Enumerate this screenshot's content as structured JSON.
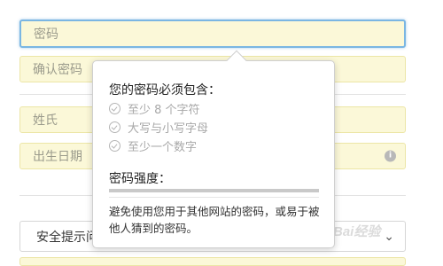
{
  "form": {
    "password_placeholder": "密码",
    "confirm_placeholder": "确认密码",
    "lastname_placeholder": "姓氏",
    "birthdate_placeholder": "出生日期",
    "security_question_label": "安全提示问题"
  },
  "popover": {
    "title": "您的密码必须包含：",
    "requirements": [
      {
        "text": "至少 8 个字符",
        "met": false
      },
      {
        "text": "大写与小写字母",
        "met": false
      },
      {
        "text": "至少一个数字",
        "met": false
      }
    ],
    "strength_label": "密码强度：",
    "strength_level": 0,
    "hint": "避免使用您用于其他网站的密码，或易于被他人猜到的密码。"
  },
  "watermark": {
    "text": "Bai经验"
  },
  "colors": {
    "field_bg": "#fbf8d8",
    "focus_border": "#7ab6e3",
    "strength_bar": "#c9c9c9"
  },
  "icons": {
    "requirement": "check-circle-icon",
    "birthdate_info": "info-icon",
    "select": "chevron-down-icon"
  }
}
